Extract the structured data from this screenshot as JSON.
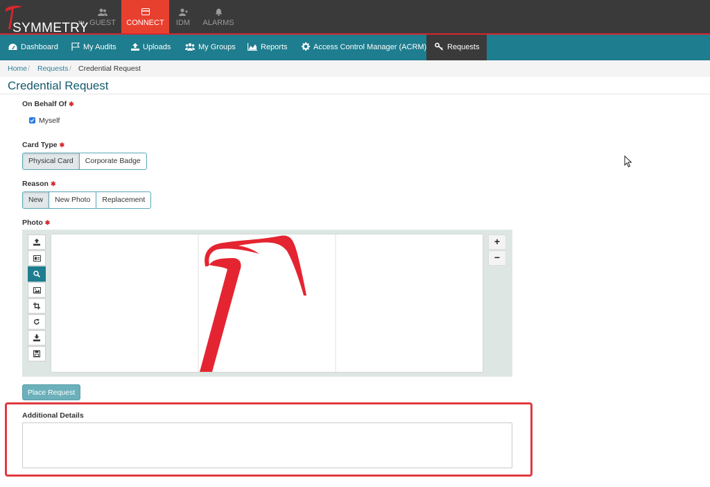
{
  "brand": {
    "name": "SYMMETRY",
    "tm": "TM",
    "accent": "#e8402f",
    "teal": "#1e7d8e",
    "dark": "#3a3a3a"
  },
  "top_nav": [
    {
      "label": "GUEST",
      "icon": "users-icon",
      "active": false
    },
    {
      "label": "CONNECT",
      "icon": "card-icon",
      "active": true
    },
    {
      "label": "IDM",
      "icon": "user-add-icon",
      "active": false
    },
    {
      "label": "ALARMS",
      "icon": "bell-icon",
      "active": false
    }
  ],
  "main_nav": [
    {
      "label": "Dashboard",
      "icon": "dashboard-icon",
      "active": false
    },
    {
      "label": "My Audits",
      "icon": "flag-icon",
      "active": false
    },
    {
      "label": "Uploads",
      "icon": "upload-icon",
      "active": false
    },
    {
      "label": "My Groups",
      "icon": "group-icon",
      "active": false
    },
    {
      "label": "Reports",
      "icon": "chart-icon",
      "active": false
    },
    {
      "label": "Access Control Manager (ACRM)",
      "icon": "gear-icon",
      "active": false
    },
    {
      "label": "Requests",
      "icon": "key-icon",
      "active": true
    }
  ],
  "breadcrumb": {
    "home": "Home",
    "requests": "Requests",
    "current": "Credential Request",
    "separator": "/"
  },
  "page_title": "Credential Request",
  "form": {
    "on_behalf_of": {
      "label": "On Behalf Of",
      "required": "✱",
      "checkbox_label": "Myself",
      "checked": true
    },
    "card_type": {
      "label": "Card Type",
      "required": "✱",
      "options": [
        "Physical Card",
        "Corporate Badge"
      ],
      "selected": "Physical Card"
    },
    "reason": {
      "label": "Reason",
      "required": "✱",
      "options": [
        "New",
        "New Photo",
        "Replacement"
      ],
      "selected": "New"
    },
    "photo": {
      "label": "Photo",
      "required": "✱",
      "tools": [
        "upload-icon",
        "id-card-icon",
        "search-icon",
        "image-icon",
        "crop-icon",
        "rotate-icon",
        "download-icon",
        "save-icon"
      ],
      "active_tool": "search-icon",
      "zoom_in": "+",
      "zoom_out": "−"
    },
    "place_request_label": "Place Request",
    "additional_details": {
      "label": "Additional Details",
      "value": ""
    }
  }
}
